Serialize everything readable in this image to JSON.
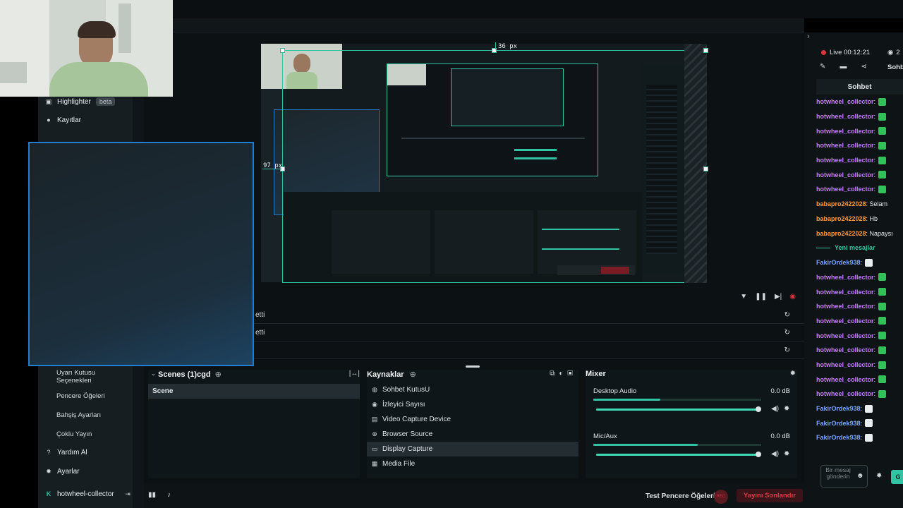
{
  "app": {
    "user": "hotwheel-collector"
  },
  "sidebar": {
    "highlighter": {
      "label": "Highlighter",
      "badge": "beta"
    },
    "recordings": "Kayıtlar",
    "items": [
      "Uyarı Kutusu Seçenekleri",
      "Pencere Öğeleri",
      "Bahşiş Ayarları",
      "Çoklu Yayın"
    ],
    "help": "Yardım Al",
    "settings": "Ayarlar"
  },
  "preview": {
    "measure_top": "36 px",
    "measure_left": "97 px"
  },
  "scene_rows": [
    "etti",
    "etti",
    ""
  ],
  "scenes": {
    "title": "Scenes (1)cgd",
    "items": [
      "Scene"
    ]
  },
  "sources": {
    "title": "Kaynaklar",
    "items": [
      {
        "label": "Sohbet KutusU",
        "icon": "chat-icon"
      },
      {
        "label": "İzleyici Sayısı",
        "icon": "eye-icon"
      },
      {
        "label": "Video Capture Device",
        "icon": "camera-icon"
      },
      {
        "label": "Browser Source",
        "icon": "globe-icon"
      },
      {
        "label": "Display Capture",
        "icon": "monitor-icon",
        "selected": true
      },
      {
        "label": "Media File",
        "icon": "media-icon"
      }
    ]
  },
  "mixer": {
    "title": "Mixer",
    "channels": [
      {
        "name": "Desktop Audio",
        "level": "0.0 dB",
        "meter": 0.4,
        "volume": 1.0
      },
      {
        "name": "Mic/Aux",
        "level": "0.0 dB",
        "meter": 0.62,
        "volume": 1.0
      }
    ]
  },
  "footer": {
    "test_widgets": "Test Pencere Öğeleri",
    "rec": "REC",
    "end_stream": "Yayını Sonlandır"
  },
  "chat": {
    "status": "Live 00:12:21",
    "viewers": "2",
    "tab": "Sohb",
    "title": "Sohbet",
    "new_messages": "Yeni mesajlar",
    "input_placeholder": "Bir mesaj gönderin",
    "send": "G",
    "messages_before": [
      {
        "user": "hotwheel_collector",
        "text": ":",
        "color": "#c77dff"
      },
      {
        "user": "hotwheel_collector",
        "text": ":",
        "color": "#c77dff"
      },
      {
        "user": "hotwheel_collector",
        "text": ":",
        "color": "#c77dff"
      },
      {
        "user": "hotwheel_collector",
        "text": ":",
        "color": "#c77dff"
      },
      {
        "user": "hotwheel_collector",
        "text": ":",
        "color": "#c77dff"
      },
      {
        "user": "hotwheel_collector",
        "text": ":",
        "color": "#c77dff"
      },
      {
        "user": "hotwheel_collector",
        "text": ":",
        "color": "#c77dff"
      },
      {
        "user": "babapro2422028",
        "text": ": Selam",
        "color": "#ff9a3c"
      },
      {
        "user": "babapro2422028",
        "text": ": Hb",
        "color": "#ff9a3c"
      },
      {
        "user": "babapro2422028",
        "text": ": Napaysı",
        "color": "#ff9a3c"
      }
    ],
    "messages_after": [
      {
        "user": "FakirOrdek938",
        "text": ":",
        "color": "#7aa6ff"
      },
      {
        "user": "hotwheel_collector",
        "text": ":",
        "color": "#c77dff"
      },
      {
        "user": "hotwheel_collector",
        "text": ":",
        "color": "#c77dff"
      },
      {
        "user": "hotwheel_collector",
        "text": ":",
        "color": "#c77dff"
      },
      {
        "user": "hotwheel_collector",
        "text": ":",
        "color": "#c77dff"
      },
      {
        "user": "hotwheel_collector",
        "text": ":",
        "color": "#c77dff"
      },
      {
        "user": "hotwheel_collector",
        "text": ":",
        "color": "#c77dff"
      },
      {
        "user": "hotwheel_collector",
        "text": ":",
        "color": "#c77dff"
      },
      {
        "user": "hotwheel_collector",
        "text": ":",
        "color": "#c77dff"
      },
      {
        "user": "hotwheel_collector",
        "text": ":",
        "color": "#c77dff"
      },
      {
        "user": "FakirOrdek938",
        "text": ":",
        "color": "#7aa6ff"
      },
      {
        "user": "FakirOrdek938",
        "text": ":",
        "color": "#7aa6ff"
      },
      {
        "user": "FakirOrdek938",
        "text": ":",
        "color": "#7aa6ff"
      }
    ]
  },
  "colors": {
    "accent": "#31c3a2",
    "live": "#e0323e",
    "selection": "#1f7fd6"
  }
}
